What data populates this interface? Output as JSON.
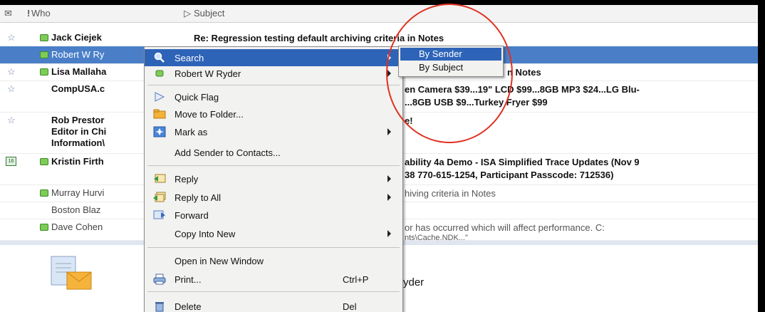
{
  "columns": {
    "who": "Who",
    "subject": "Subject",
    "flag": "!"
  },
  "rows": [
    {
      "who": "Jack Ciejek",
      "subject": "Re: Regression testing default archiving criteria in Notes",
      "bold": true,
      "icon": "star-icon"
    },
    {
      "who": "Robert W Ry",
      "subject": "",
      "bold": false,
      "selected": true,
      "icon": "star-icon"
    },
    {
      "who": "Lisa Mallaha",
      "subject": "n Notes",
      "bold": true,
      "icon": "star-icon"
    },
    {
      "who": "CompUSA.c",
      "subject_line1": "en Camera $39...19\" LCD $99...8GB MP3 $24...LG Blu-",
      "subject_line2": "...8GB USB $9...Turkey Fryer $99",
      "bold": true,
      "icon": "star-icon"
    },
    {
      "who_line1": "Rob Prestor",
      "who_line2": "Editor in Chi",
      "who_line3": "Information\\",
      "subject": "e!",
      "bold": true,
      "icon": "star-icon"
    },
    {
      "who": "Kristin Firth",
      "subject_line1": "ability 4a Demo - ISA Simplified Trace Updates (Nov 9",
      "subject_line2": "38 770-615-1254, Participant Passcode: 712536)",
      "bold": true,
      "icon": "calendar-icon",
      "cal_text": "16"
    },
    {
      "who": "Murray Hurvi",
      "subject": "hiving criteria in Notes",
      "bold": false
    },
    {
      "who": "Boston Blaz",
      "subject": "",
      "bold": false
    },
    {
      "who": "Dave Cohen",
      "subject_line1": "or has occurred which will affect performance. C:",
      "subject_line2": "nts\\Cache.NDK...\"",
      "bold": false
    }
  ],
  "preview": {
    "name_partial": "yder"
  },
  "context_menu": [
    {
      "label": "Search",
      "icon": "magnifier-icon",
      "submenu": true,
      "highlighted": true
    },
    {
      "label": "Robert W Ryder",
      "icon": "presence-icon",
      "submenu": true
    },
    {
      "separator": true
    },
    {
      "label": "Quick Flag",
      "icon": "flag-icon"
    },
    {
      "label": "Move to Folder...",
      "icon": "folder-icon"
    },
    {
      "label": "Mark as",
      "icon": "mark-icon",
      "submenu": true
    },
    {
      "label": "Add Sender to Contacts..."
    },
    {
      "separator": true
    },
    {
      "label": "Reply",
      "icon": "reply-icon",
      "submenu": true
    },
    {
      "label": "Reply to All",
      "icon": "reply-all-icon",
      "submenu": true
    },
    {
      "label": "Forward",
      "icon": "forward-icon"
    },
    {
      "label": "Copy Into New",
      "submenu": true
    },
    {
      "separator": true
    },
    {
      "label": "Open in New Window"
    },
    {
      "label": "Print...",
      "icon": "printer-icon",
      "accel": "Ctrl+P"
    },
    {
      "separator": true
    },
    {
      "label": "Delete",
      "icon": "trash-icon",
      "accel": "Del"
    }
  ],
  "submenu": [
    {
      "label": "By Sender",
      "highlighted": true
    },
    {
      "label": "By Subject"
    }
  ],
  "colors": {
    "selection": "#4a7fc8",
    "menu_highlight": "#2e64b8",
    "annotation_circle": "#e03020"
  }
}
